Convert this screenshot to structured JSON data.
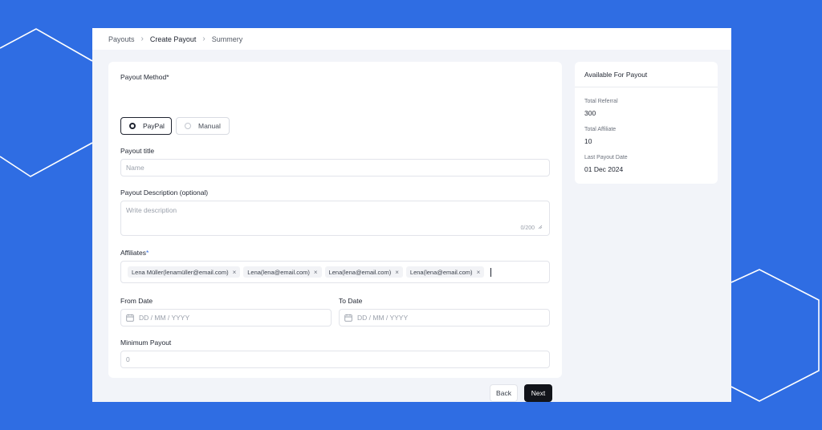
{
  "breadcrumb": [
    "Payouts",
    "Create Payout",
    "Summery"
  ],
  "form": {
    "payout_method_label": "Payout Method",
    "required_mark": "*",
    "methods": [
      {
        "label": "PayPal",
        "selected": true
      },
      {
        "label": "Manual",
        "selected": false
      }
    ],
    "payout_title_label": "Payout title",
    "payout_title_placeholder": "Name",
    "description_label": "Payout Description (optional)",
    "description_placeholder": "Write description",
    "description_counter": "0/200",
    "affiliates_label": "Affiliates",
    "affiliates": [
      "Lena Müller(lenamüller@email.com)",
      "Lena(lena@email.com)",
      "Lena(lena@email.com)",
      "Lena(lena@email.com)"
    ],
    "from_date_label": "From Date",
    "to_date_label": "To Date",
    "date_placeholder": "DD / MM / YYYY",
    "minimum_payout_label": "Minimum Payout",
    "minimum_payout_placeholder": "0",
    "back_label": "Back",
    "next_label": "Next"
  },
  "summary": {
    "title": "Available For Payout",
    "stats": [
      {
        "label": "Total Referral",
        "value": "300"
      },
      {
        "label": "Total Affiliate",
        "value": "10"
      },
      {
        "label": "Last Payout Date",
        "value": "01 Dec 2024"
      }
    ]
  },
  "icons": {
    "chip_remove": "close-icon",
    "date": "calendar-icon",
    "breadcrumb_separator": "chevron-right-icon"
  },
  "colors": {
    "background": "#2f6de3",
    "primary_button": "#12141a",
    "required_mark": "#2f6de3"
  }
}
